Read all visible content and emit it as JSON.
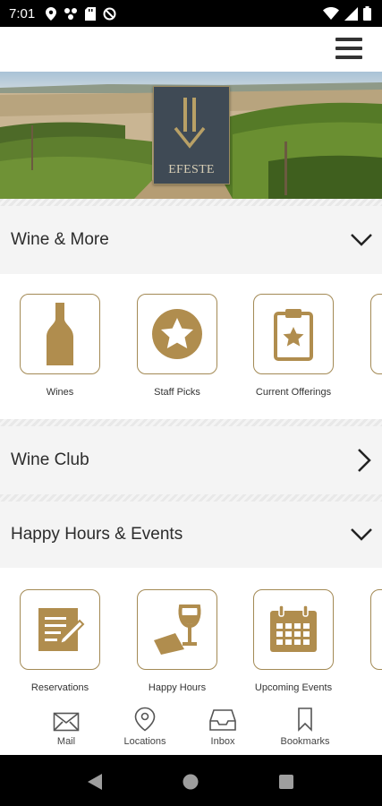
{
  "status_bar": {
    "time": "7:01",
    "left_icons": [
      "location-icon",
      "fan-icon",
      "sd-card-icon",
      "do-not-disturb-icon"
    ],
    "right_icons": [
      "wifi-icon",
      "signal-icon",
      "battery-icon"
    ]
  },
  "app_bar": {
    "menu_icon": "hamburger-menu-icon"
  },
  "hero": {
    "brand": "EFESTE"
  },
  "sections": {
    "wine_more": {
      "title": "Wine & More",
      "chevron": "chevron-down-icon",
      "tiles": [
        {
          "label": "Wines",
          "icon": "wine-bottle-icon"
        },
        {
          "label": "Staff Picks",
          "icon": "star-badge-icon"
        },
        {
          "label": "Current Offerings",
          "icon": "clipboard-star-icon"
        }
      ]
    },
    "wine_club": {
      "title": "Wine Club",
      "chevron": "chevron-right-icon"
    },
    "happy_hours": {
      "title": "Happy Hours & Events",
      "chevron": "chevron-down-icon",
      "tiles": [
        {
          "label": "Reservations",
          "icon": "notepad-pen-icon"
        },
        {
          "label": "Happy Hours",
          "icon": "wine-glass-ticket-icon"
        },
        {
          "label": "Upcoming Events",
          "icon": "calendar-icon"
        }
      ]
    }
  },
  "tab_bar": {
    "tabs": [
      {
        "label": "Mail",
        "icon": "mail-icon"
      },
      {
        "label": "Locations",
        "icon": "location-pin-icon"
      },
      {
        "label": "Inbox",
        "icon": "inbox-icon"
      },
      {
        "label": "Bookmarks",
        "icon": "bookmark-icon"
      }
    ]
  },
  "colors": {
    "accent": "#a38a55",
    "logo_bg": "#3f4a55",
    "section_bg": "#f4f4f4"
  }
}
